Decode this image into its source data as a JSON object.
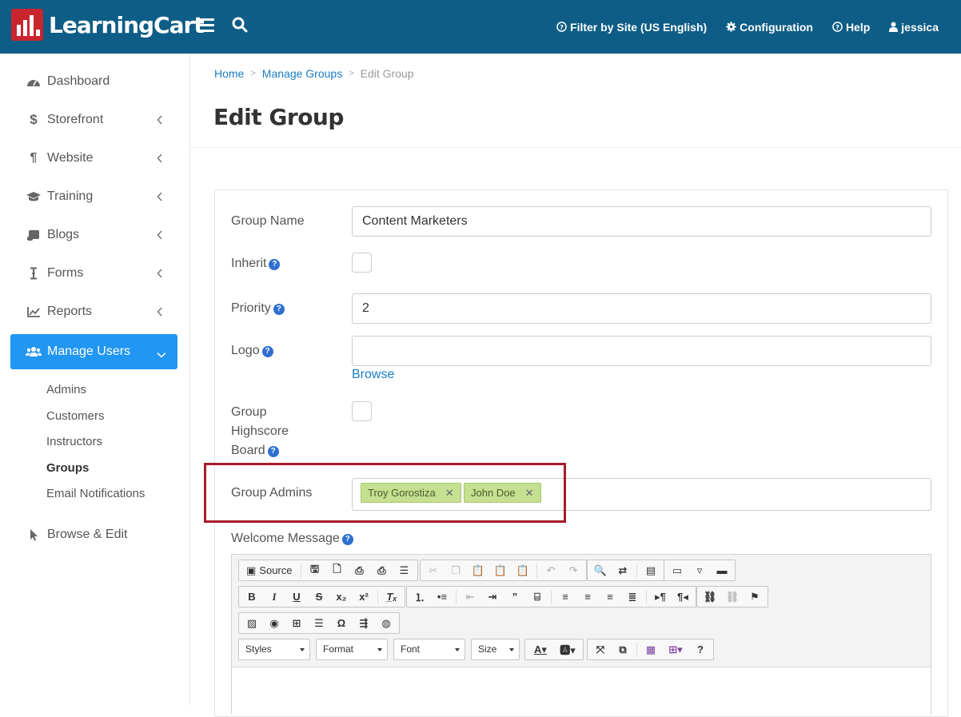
{
  "app": {
    "name": "LearningCart"
  },
  "topnav": {
    "filter_label": "Filter by Site (US English)",
    "configuration_label": "Configuration",
    "help_label": "Help",
    "user_label": "jessica"
  },
  "sidebar": {
    "items": [
      {
        "label": "Dashboard"
      },
      {
        "label": "Storefront"
      },
      {
        "label": "Website"
      },
      {
        "label": "Training"
      },
      {
        "label": "Blogs"
      },
      {
        "label": "Forms"
      },
      {
        "label": "Reports"
      },
      {
        "label": "Manage Users"
      },
      {
        "label": "Browse & Edit"
      }
    ],
    "sub_items": [
      {
        "label": "Admins"
      },
      {
        "label": "Customers"
      },
      {
        "label": "Instructors"
      },
      {
        "label": "Groups"
      },
      {
        "label": "Email Notifications"
      }
    ]
  },
  "breadcrumb": {
    "home": "Home",
    "manage_groups": "Manage Groups",
    "current": "Edit Group"
  },
  "page_title": "Edit Group",
  "form": {
    "group_name_label": "Group Name",
    "group_name_value": "Content Marketers",
    "inherit_label": "Inherit",
    "priority_label": "Priority",
    "priority_value": "2",
    "logo_label": "Logo",
    "logo_value": "",
    "browse_label": "Browse",
    "highscore_label_1": "Group",
    "highscore_label_2": "Highscore",
    "highscore_label_3": "Board",
    "group_admins_label": "Group Admins",
    "group_admins": [
      "Troy Gorostiza",
      "John Doe"
    ],
    "welcome_label": "Welcome Message",
    "help_glyph": "?"
  },
  "editor": {
    "source_label": "Source",
    "styles_label": "Styles",
    "format_label": "Format",
    "font_label": "Font",
    "size_label": "Size"
  },
  "colors": {
    "topbar": "#0e5d86",
    "active_nav": "#2196f3",
    "link": "#1a7bc4",
    "highlight": "#a61c2a",
    "tag_bg": "#c5e090"
  }
}
